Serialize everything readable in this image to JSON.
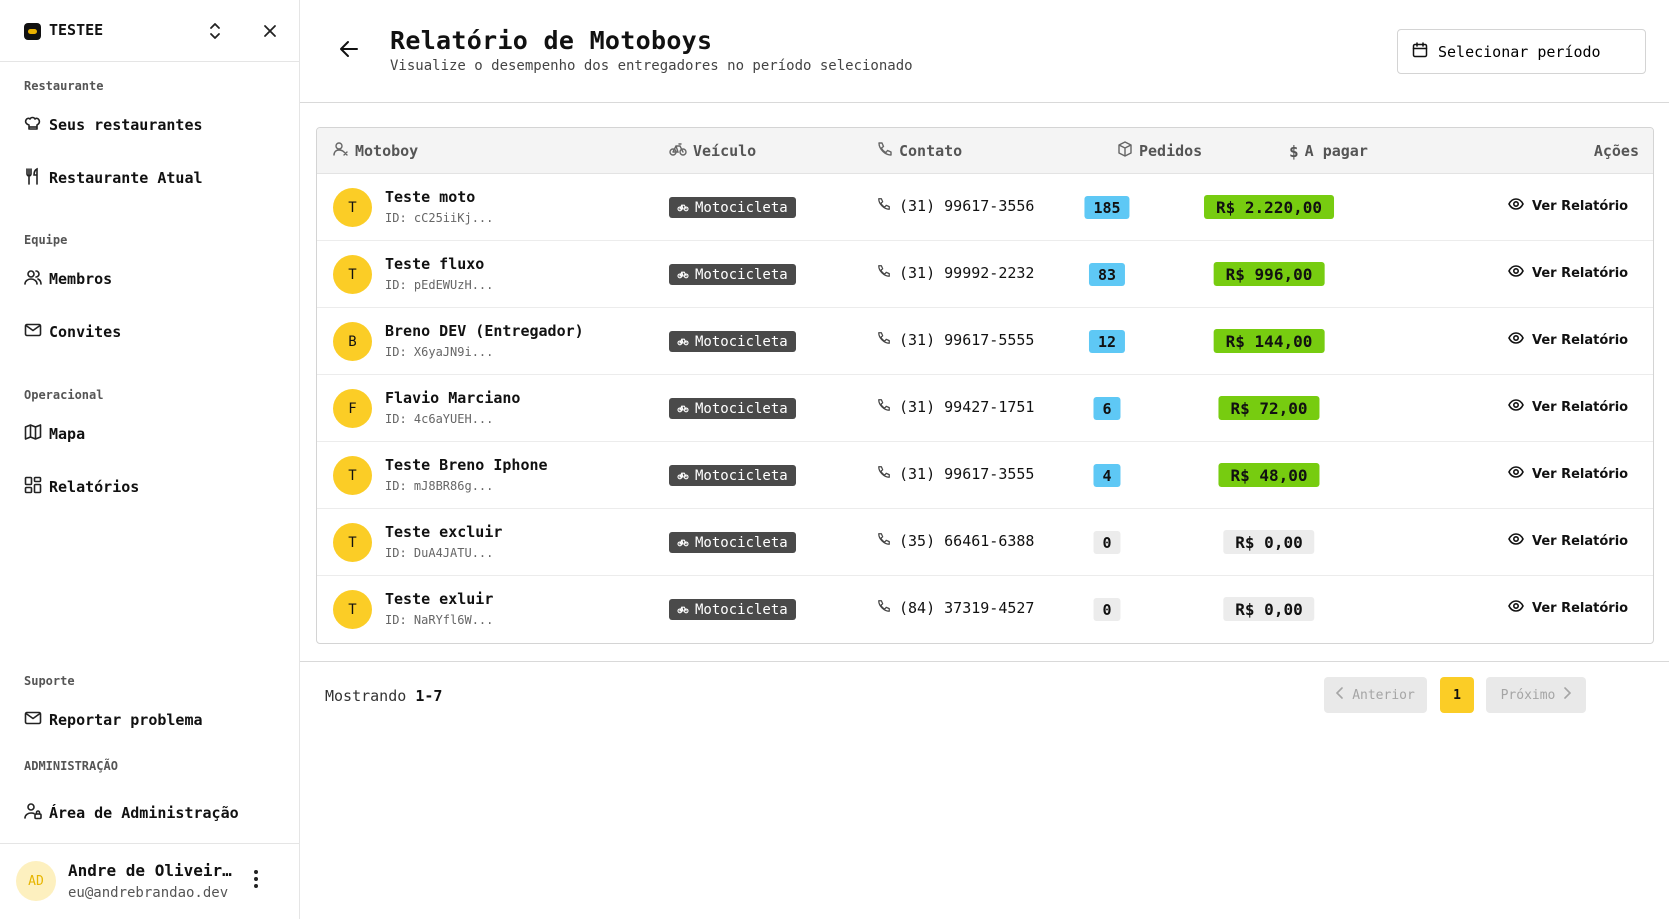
{
  "sidebar": {
    "org_name": "TESTEE",
    "sections": {
      "restaurante": "Restaurante",
      "equipe": "Equipe",
      "operacional": "Operacional",
      "suporte": "Suporte",
      "administracao": "ADMINISTRAÇÃO"
    },
    "items": {
      "seus_restaurantes": "Seus restaurantes",
      "restaurante_atual": "Restaurante Atual",
      "membros": "Membros",
      "convites": "Convites",
      "mapa": "Mapa",
      "relatorios": "Relatórios",
      "reportar": "Reportar problema",
      "admin": "Área de Administração"
    },
    "user": {
      "initials": "AD",
      "name": "Andre de Oliveira Brandão",
      "email": "eu@andrebrandao.dev"
    }
  },
  "header": {
    "title": "Relatório de Motoboys",
    "subtitle": "Visualize o desempenho dos entregadores no período selecionado",
    "period_button": "Selecionar período"
  },
  "table": {
    "columns": {
      "motoboy": "Motoboy",
      "veiculo": "Veículo",
      "contato": "Contato",
      "pedidos": "Pedidos",
      "a_pagar": "A pagar",
      "acoes": "Ações"
    },
    "action_label": "Ver Relatório",
    "rows": [
      {
        "initial": "T",
        "name": "Teste moto",
        "id": "ID: cC25iiKj...",
        "vehicle": "Motocicleta",
        "phone": "(31) 99617-3556",
        "orders": "185",
        "pay": "R$ 2.220,00"
      },
      {
        "initial": "T",
        "name": "Teste fluxo",
        "id": "ID: pEdEWUzH...",
        "vehicle": "Motocicleta",
        "phone": "(31) 99992-2232",
        "orders": "83",
        "pay": "R$ 996,00"
      },
      {
        "initial": "B",
        "name": "Breno DEV (Entregador)",
        "id": "ID: X6yaJN9i...",
        "vehicle": "Motocicleta",
        "phone": "(31) 99617-5555",
        "orders": "12",
        "pay": "R$ 144,00"
      },
      {
        "initial": "F",
        "name": "Flavio Marciano",
        "id": "ID: 4c6aYUEH...",
        "vehicle": "Motocicleta",
        "phone": "(31) 99427-1751",
        "orders": "6",
        "pay": "R$ 72,00"
      },
      {
        "initial": "T",
        "name": "Teste Breno Iphone",
        "id": "ID: mJ8BR86g...",
        "vehicle": "Motocicleta",
        "phone": "(31) 99617-3555",
        "orders": "4",
        "pay": "R$ 48,00"
      },
      {
        "initial": "T",
        "name": "Teste excluir",
        "id": "ID: DuA4JATU...",
        "vehicle": "Motocicleta",
        "phone": "(35) 66461-6388",
        "orders": "0",
        "pay": "R$ 0,00"
      },
      {
        "initial": "T",
        "name": "Teste exluir",
        "id": "ID: NaRYfl6W...",
        "vehicle": "Motocicleta",
        "phone": "(84) 37319-4527",
        "orders": "0",
        "pay": "R$ 0,00"
      }
    ]
  },
  "pagination": {
    "showing_label": "Mostrando",
    "range": "1-7",
    "prev": "Anterior",
    "current": "1",
    "next": "Próximo"
  },
  "colors": {
    "accent": "#fbcd26",
    "orders_active": "#5ec8f5",
    "pay_active": "#77cc10",
    "inactive": "#ececec",
    "vehicle_badge": "#4a4a4a"
  }
}
